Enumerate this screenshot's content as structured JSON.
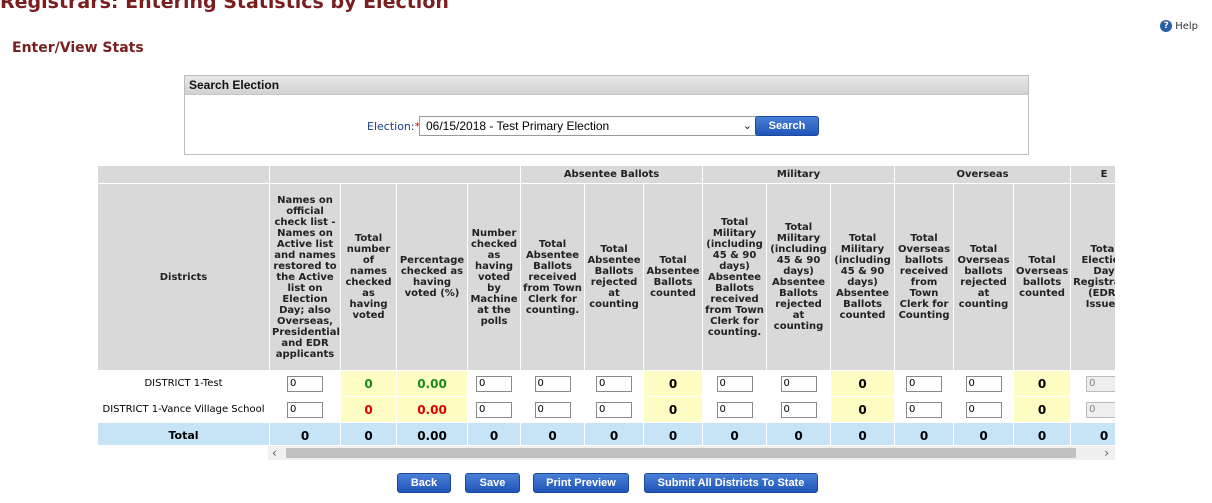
{
  "page": {
    "top_title": "Registrars: Entering Statistics by Election",
    "help_label": "Help",
    "section_title": "Enter/View Stats"
  },
  "search": {
    "header": "Search Election",
    "label": "Election:",
    "required": "*",
    "selected": "06/15/2018 - Test Primary Election",
    "button": "Search"
  },
  "table": {
    "groups": [
      "",
      "",
      "Absentee Ballots",
      "Military",
      "Overseas",
      "E"
    ],
    "columns": [
      "Districts",
      "Names on official check list - Names on Active list and names restored to the Active list on Election Day; also Overseas, Presidential and EDR applicants",
      "Total number of names checked as having voted",
      "Percentage checked as having voted (%)",
      "Number checked as having voted by Machine at the polls",
      "Total Absentee Ballots received from Town Clerk for counting.",
      "Total Absentee Ballots rejected at counting",
      "Total Absentee Ballots counted",
      "Total Military (including 45 & 90 days) Absentee Ballots received from Town Clerk for counting.",
      "Total Military (including 45 & 90 days) Absentee Ballots rejected at counting",
      "Total Military (including 45 & 90 days) Absentee Ballots counted",
      "Total Overseas ballots received from Town Clerk for Counting",
      "Total Overseas ballots rejected at counting",
      "Total Overseas ballots counted",
      "Total Election Day Registrations (EDR) Issued"
    ],
    "rows": [
      {
        "district": "DISTRICT 1-Test",
        "names_on_list": "0",
        "total_checked": "0",
        "percentage": "0.00",
        "machine": "0",
        "absentee_received": "0",
        "absentee_rejected": "0",
        "absentee_counted": "0",
        "military_received": "0",
        "military_rejected": "0",
        "military_counted": "0",
        "overseas_received": "0",
        "overseas_rejected": "0",
        "overseas_counted": "0",
        "edr": "0"
      },
      {
        "district": "DISTRICT 1-Vance Village School",
        "names_on_list": "0",
        "total_checked": "0",
        "percentage": "0.00",
        "machine": "0",
        "absentee_received": "0",
        "absentee_rejected": "0",
        "absentee_counted": "0",
        "military_received": "0",
        "military_rejected": "0",
        "military_counted": "0",
        "overseas_received": "0",
        "overseas_rejected": "0",
        "overseas_counted": "0",
        "edr": "0"
      }
    ],
    "total": {
      "label": "Total",
      "names_on_list": "0",
      "total_checked": "0",
      "percentage": "0.00",
      "machine": "0",
      "absentee_received": "0",
      "absentee_rejected": "0",
      "absentee_counted": "0",
      "military_received": "0",
      "military_rejected": "0",
      "military_counted": "0",
      "overseas_received": "0",
      "overseas_rejected": "0",
      "overseas_counted": "0",
      "edr": "0"
    },
    "colors": {
      "calc_bg": "#fdfdc4",
      "total_bg": "#c6e4f6",
      "header_bg": "#d9d9d9",
      "green": "#1a8a1a",
      "red": "#e00000"
    }
  },
  "scrollbar": {
    "left_arrow": "‹",
    "right_arrow": "›"
  },
  "actions": {
    "back": "Back",
    "save": "Save",
    "print_preview": "Print Preview",
    "submit": "Submit All Districts To State"
  }
}
